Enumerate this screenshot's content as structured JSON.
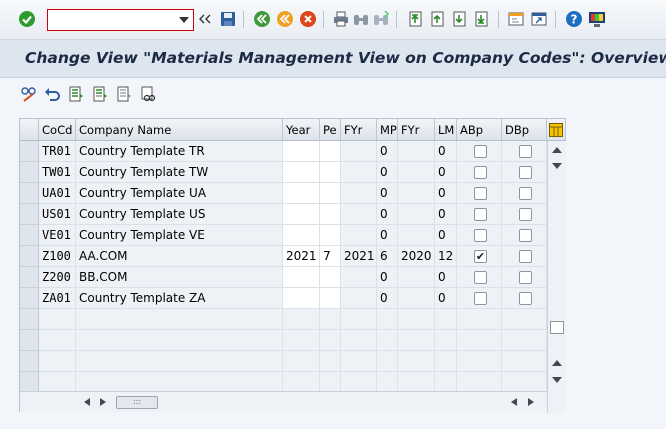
{
  "toolbar": {
    "command_value": "",
    "icons": [
      "enter-icon",
      "command-dropdown-icon",
      "history-back-icon",
      "save-icon",
      "back-icon",
      "exit-icon",
      "cancel-icon",
      "print-icon",
      "find-icon",
      "find-next-icon",
      "first-page-icon",
      "previous-page-icon",
      "next-page-icon",
      "last-page-icon",
      "new-session-icon",
      "create-shortcut-icon",
      "help-icon",
      "customize-layout-icon"
    ]
  },
  "title": "Change View \"Materials Management View on Company Codes\": Overview",
  "app_toolbar": {
    "icons": [
      "change-display-icon",
      "undo-icon",
      "select-all-icon",
      "select-block-icon",
      "deselect-all-icon",
      "choose-icon"
    ]
  },
  "table": {
    "columns": [
      "CoCd",
      "Company Name",
      "Year",
      "Pe",
      "FYr",
      "MP",
      "FYr",
      "LM",
      "ABp",
      "DBp"
    ],
    "rows": [
      {
        "cocd": "TR01",
        "name": "Country Template TR",
        "year": "",
        "pe": "",
        "fyr": "",
        "mp": "0",
        "fyr2": "",
        "lm": "0",
        "abp": false,
        "dbp": false
      },
      {
        "cocd": "TW01",
        "name": "Country Template TW",
        "year": "",
        "pe": "",
        "fyr": "",
        "mp": "0",
        "fyr2": "",
        "lm": "0",
        "abp": false,
        "dbp": false
      },
      {
        "cocd": "UA01",
        "name": "Country Template UA",
        "year": "",
        "pe": "",
        "fyr": "",
        "mp": "0",
        "fyr2": "",
        "lm": "0",
        "abp": false,
        "dbp": false
      },
      {
        "cocd": "US01",
        "name": "Country Template US",
        "year": "",
        "pe": "",
        "fyr": "",
        "mp": "0",
        "fyr2": "",
        "lm": "0",
        "abp": false,
        "dbp": false
      },
      {
        "cocd": "VE01",
        "name": "Country Template VE",
        "year": "",
        "pe": "",
        "fyr": "",
        "mp": "0",
        "fyr2": "",
        "lm": "0",
        "abp": false,
        "dbp": false
      },
      {
        "cocd": "Z100",
        "name": "AA.COM",
        "year": "2021",
        "pe": "7",
        "fyr": "2021",
        "mp": "6",
        "fyr2": "2020",
        "lm": "12",
        "abp": true,
        "dbp": false
      },
      {
        "cocd": "Z200",
        "name": "BB.COM",
        "year": "",
        "pe": "",
        "fyr": "",
        "mp": "0",
        "fyr2": "",
        "lm": "0",
        "abp": false,
        "dbp": false
      },
      {
        "cocd": "ZA01",
        "name": "Country Template ZA",
        "year": "",
        "pe": "",
        "fyr": "",
        "mp": "0",
        "fyr2": "",
        "lm": "0",
        "abp": false,
        "dbp": false
      }
    ],
    "empty_rows": 4,
    "scroll_thumb_label": ":::"
  },
  "colors": {
    "enter_green": "#2d9b2d",
    "save_blue": "#2d5f9e",
    "cancel_red": "#d9471a",
    "help_blue": "#1e6fc2",
    "title_text": "#1b2a45"
  }
}
